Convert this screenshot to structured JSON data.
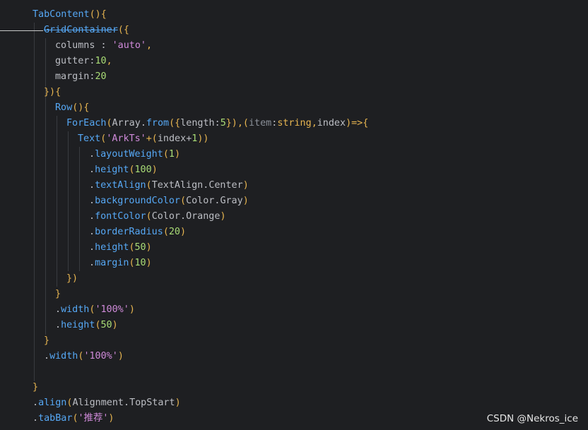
{
  "colors": {
    "background": "#1e1f22",
    "function": "#56a8f5",
    "text": "#bcbec4",
    "punctuation": "#e6b450",
    "string": "#cf8ad9",
    "number": "#a9dc76",
    "parameter": "#8a8f98"
  },
  "code": {
    "lines": [
      [
        {
          "t": "TabContent",
          "k": "fn"
        },
        {
          "t": "(){",
          "k": "punct"
        }
      ],
      [
        {
          "t": "GridContainer",
          "k": "fn",
          "s": true
        },
        {
          "t": "({",
          "k": "punct"
        }
      ],
      [
        {
          "t": "columns",
          "k": "text"
        },
        {
          "t": " : ",
          "k": "text"
        },
        {
          "t": "'auto'",
          "k": "str"
        },
        {
          "t": ",",
          "k": "punct"
        }
      ],
      [
        {
          "t": "gutter",
          "k": "text"
        },
        {
          "t": ":",
          "k": "text"
        },
        {
          "t": "10",
          "k": "num"
        },
        {
          "t": ",",
          "k": "punct"
        }
      ],
      [
        {
          "t": "margin",
          "k": "text"
        },
        {
          "t": ":",
          "k": "text"
        },
        {
          "t": "20",
          "k": "num"
        }
      ],
      [
        {
          "t": "}){",
          "k": "punct"
        }
      ],
      [
        {
          "t": "Row",
          "k": "fn"
        },
        {
          "t": "(){",
          "k": "punct"
        }
      ],
      [
        {
          "t": "ForEach",
          "k": "fn"
        },
        {
          "t": "(",
          "k": "punct"
        },
        {
          "t": "Array",
          "k": "text"
        },
        {
          "t": ".",
          "k": "text"
        },
        {
          "t": "from",
          "k": "method"
        },
        {
          "t": "({",
          "k": "punct"
        },
        {
          "t": "length",
          "k": "text"
        },
        {
          "t": ":",
          "k": "text"
        },
        {
          "t": "5",
          "k": "num"
        },
        {
          "t": "}),(",
          "k": "punct"
        },
        {
          "t": "item",
          "k": "param"
        },
        {
          "t": ":",
          "k": "text"
        },
        {
          "t": "string",
          "k": "type"
        },
        {
          "t": ",",
          "k": "punct"
        },
        {
          "t": "index",
          "k": "text"
        },
        {
          "t": ")=>{",
          "k": "punct"
        }
      ],
      [
        {
          "t": "Text",
          "k": "fn"
        },
        {
          "t": "(",
          "k": "punct"
        },
        {
          "t": "'ArkTs'",
          "k": "str"
        },
        {
          "t": "+(",
          "k": "punct"
        },
        {
          "t": "index",
          "k": "text"
        },
        {
          "t": "+",
          "k": "text"
        },
        {
          "t": "1",
          "k": "num"
        },
        {
          "t": "))",
          "k": "punct"
        }
      ],
      [
        {
          "t": ".",
          "k": "text"
        },
        {
          "t": "layoutWeight",
          "k": "method"
        },
        {
          "t": "(",
          "k": "punct"
        },
        {
          "t": "1",
          "k": "num"
        },
        {
          "t": ")",
          "k": "punct"
        }
      ],
      [
        {
          "t": ".",
          "k": "text"
        },
        {
          "t": "height",
          "k": "method"
        },
        {
          "t": "(",
          "k": "punct"
        },
        {
          "t": "100",
          "k": "num"
        },
        {
          "t": ")",
          "k": "punct"
        }
      ],
      [
        {
          "t": ".",
          "k": "text"
        },
        {
          "t": "textAlign",
          "k": "method"
        },
        {
          "t": "(",
          "k": "punct"
        },
        {
          "t": "TextAlign",
          "k": "text"
        },
        {
          "t": ".",
          "k": "text"
        },
        {
          "t": "Center",
          "k": "text"
        },
        {
          "t": ")",
          "k": "punct"
        }
      ],
      [
        {
          "t": ".",
          "k": "text"
        },
        {
          "t": "backgroundColor",
          "k": "method"
        },
        {
          "t": "(",
          "k": "punct"
        },
        {
          "t": "Color",
          "k": "text"
        },
        {
          "t": ".",
          "k": "text"
        },
        {
          "t": "Gray",
          "k": "text"
        },
        {
          "t": ")",
          "k": "punct"
        }
      ],
      [
        {
          "t": ".",
          "k": "text"
        },
        {
          "t": "fontColor",
          "k": "method"
        },
        {
          "t": "(",
          "k": "punct"
        },
        {
          "t": "Color",
          "k": "text"
        },
        {
          "t": ".",
          "k": "text"
        },
        {
          "t": "Orange",
          "k": "text"
        },
        {
          "t": ")",
          "k": "punct"
        }
      ],
      [
        {
          "t": ".",
          "k": "text"
        },
        {
          "t": "borderRadius",
          "k": "method"
        },
        {
          "t": "(",
          "k": "punct"
        },
        {
          "t": "20",
          "k": "num"
        },
        {
          "t": ")",
          "k": "punct"
        }
      ],
      [
        {
          "t": ".",
          "k": "text"
        },
        {
          "t": "height",
          "k": "method"
        },
        {
          "t": "(",
          "k": "punct"
        },
        {
          "t": "50",
          "k": "num"
        },
        {
          "t": ")",
          "k": "punct"
        }
      ],
      [
        {
          "t": ".",
          "k": "text"
        },
        {
          "t": "margin",
          "k": "method"
        },
        {
          "t": "(",
          "k": "punct"
        },
        {
          "t": "10",
          "k": "num"
        },
        {
          "t": ")",
          "k": "punct"
        }
      ],
      [
        {
          "t": "})",
          "k": "punct"
        }
      ],
      [
        {
          "t": "}",
          "k": "punct"
        }
      ],
      [
        {
          "t": ".",
          "k": "text"
        },
        {
          "t": "width",
          "k": "method"
        },
        {
          "t": "(",
          "k": "punct"
        },
        {
          "t": "'100%'",
          "k": "str"
        },
        {
          "t": ")",
          "k": "punct"
        }
      ],
      [
        {
          "t": ".",
          "k": "text"
        },
        {
          "t": "height",
          "k": "method"
        },
        {
          "t": "(",
          "k": "punct"
        },
        {
          "t": "50",
          "k": "num"
        },
        {
          "t": ")",
          "k": "punct"
        }
      ],
      [
        {
          "t": "}",
          "k": "punct"
        }
      ],
      [
        {
          "t": ".",
          "k": "text"
        },
        {
          "t": "width",
          "k": "method"
        },
        {
          "t": "(",
          "k": "punct"
        },
        {
          "t": "'100%'",
          "k": "str"
        },
        {
          "t": ")",
          "k": "punct"
        }
      ],
      [],
      [
        {
          "t": "}",
          "k": "punct"
        }
      ],
      [
        {
          "t": ".",
          "k": "text"
        },
        {
          "t": "align",
          "k": "method"
        },
        {
          "t": "(",
          "k": "punct"
        },
        {
          "t": "Alignment",
          "k": "text"
        },
        {
          "t": ".",
          "k": "text"
        },
        {
          "t": "TopStart",
          "k": "text"
        },
        {
          "t": ")",
          "k": "punct"
        }
      ],
      [
        {
          "t": ".",
          "k": "text"
        },
        {
          "t": "tabBar",
          "k": "method"
        },
        {
          "t": "(",
          "k": "punct"
        },
        {
          "t": "'推荐'",
          "k": "str"
        },
        {
          "t": ")",
          "k": "punct"
        }
      ]
    ]
  },
  "watermark": "CSDN @Nekros_ice"
}
